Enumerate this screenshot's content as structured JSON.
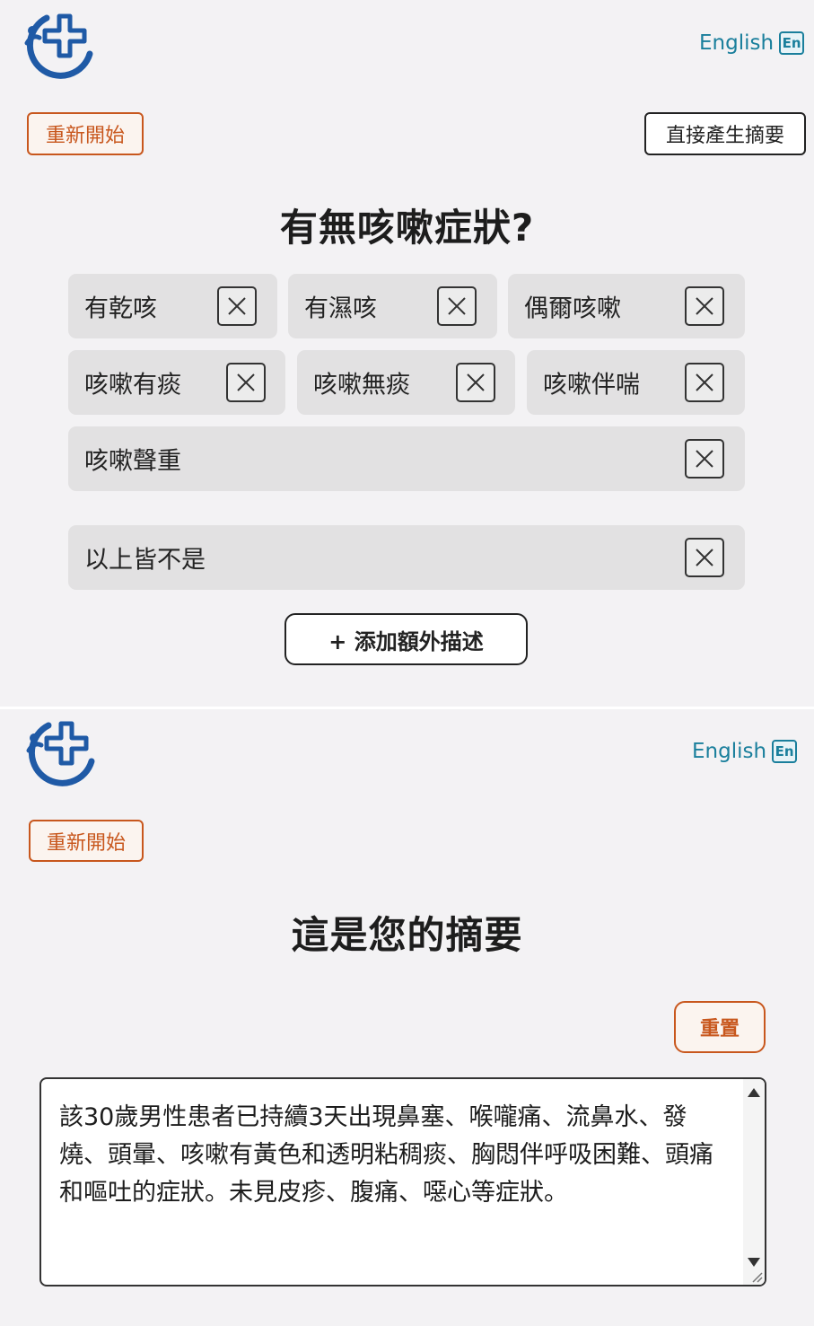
{
  "colors": {
    "accent_orange": "#c8571d",
    "link_teal": "#1a7f9c",
    "logo_blue": "#1f5aa6",
    "chip_bg": "#e2e1e2",
    "page_bg": "#f3f2f4"
  },
  "question_screen": {
    "logo_icon": "medical-cross-logo",
    "language_label": "English",
    "language_badge": "En",
    "restart_label": "重新開始",
    "generate_summary_label": "直接產生摘要",
    "question_title": "有無咳嗽症狀?",
    "options": [
      {
        "label": "有乾咳"
      },
      {
        "label": "有濕咳"
      },
      {
        "label": "偶爾咳嗽"
      },
      {
        "label": "咳嗽有痰"
      },
      {
        "label": "咳嗽無痰"
      },
      {
        "label": "咳嗽伴喘"
      },
      {
        "label": "咳嗽聲重"
      },
      {
        "label": "以上皆不是"
      }
    ],
    "add_description_label": "+ 添加額外描述"
  },
  "summary_screen": {
    "logo_icon": "medical-cross-logo",
    "language_label": "English",
    "language_badge": "En",
    "restart_label": "重新開始",
    "summary_title": "這是您的摘要",
    "reset_label": "重置",
    "summary_text": "該30歲男性患者已持續3天出現鼻塞、喉嚨痛、流鼻水、發燒、頭暈、咳嗽有黃色和透明粘稠痰、胸悶伴呼吸困難、頭痛和嘔吐的症狀。未見皮疹、腹痛、噁心等症狀。"
  }
}
